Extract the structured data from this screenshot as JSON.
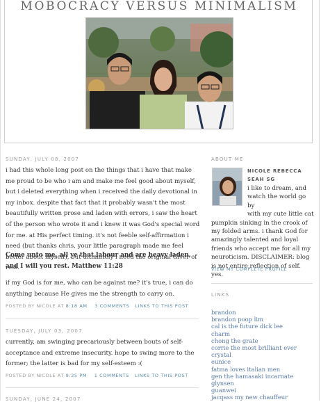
{
  "blog": {
    "title": "MOBOCRACY VERSUS MINIMALISM"
  },
  "posts": [
    {
      "date": "SUNDAY, JULY 08, 2007",
      "para1": "i had this whole long post on the things that i have that make me proud to be who i am and make me feel good about myself, but i deleted everything when i received the daily devotional in my inbox. despite that fact that it probably wasn't the most beautifully written prose and laden with errors, i saw the heart of the person who wrote it and i knew it was God's special word for me. at His perfect timing. it's not feeble self-affirmation i need (but thanks chris, your little paragraph made me feel better about myself), but ultimately i need the original Giver of rest.",
      "quote": "Come unto me, all ye that labour and are heavy laden, and I will you rest. Matthew 11:28",
      "para3": "if my God is for me, who can be against me? it's true, i can do anything because He gives me the strength to carry on.",
      "posted_by": "POSTED BY NICOLE AT",
      "time": "8:18 AM",
      "comments": "3 COMMENTS",
      "link": "LINKS TO THIS POST"
    },
    {
      "date": "TUESDAY, JULY 03, 2007",
      "para1": "currently, am swinging precariously between bouts of self-acceptance and extreme insecurity. hope to swing more to the former; the latter is bad for my self-esteem :(",
      "posted_by": "POSTED BY NICOLE AT",
      "time": "9:25 PM",
      "comments": "1 COMMENTS",
      "link": "LINKS TO THIS POST"
    },
    {
      "date": "SUNDAY, JUNE 24, 2007"
    }
  ],
  "sidebar": {
    "about_heading": "ABOUT ME",
    "profile_name": "NICOLE REBECCA SEAH SG",
    "profile_desc_1": "i like to dream, and",
    "profile_desc_2": "watch the world go by",
    "profile_desc_3": "with my cute little cat",
    "profile_desc_4": "pumpkin sinking in the crook of my folded arms. i thank God for amazingly talented and loyal friends who accept me for all my neuroticism. DISCLAIMER: blog is not entire reflection of self. yes.",
    "profile_link": "VIEW MY COMPLETE PROFILE",
    "links_heading": "LINKS",
    "links": [
      "brandon",
      "brandon poop lim",
      "cal is the future dick lee",
      "charm",
      "chong the grate",
      "corrie the most brilliant ever",
      "crystal",
      "eunice",
      "fatma loves italian men",
      "gen the hamasaki incarnate",
      "glynsen",
      "guanwei",
      "jacqass my new chauffeur"
    ]
  },
  "colors": {
    "link": "#5588aa",
    "meta": "#999999",
    "text": "#333333"
  }
}
